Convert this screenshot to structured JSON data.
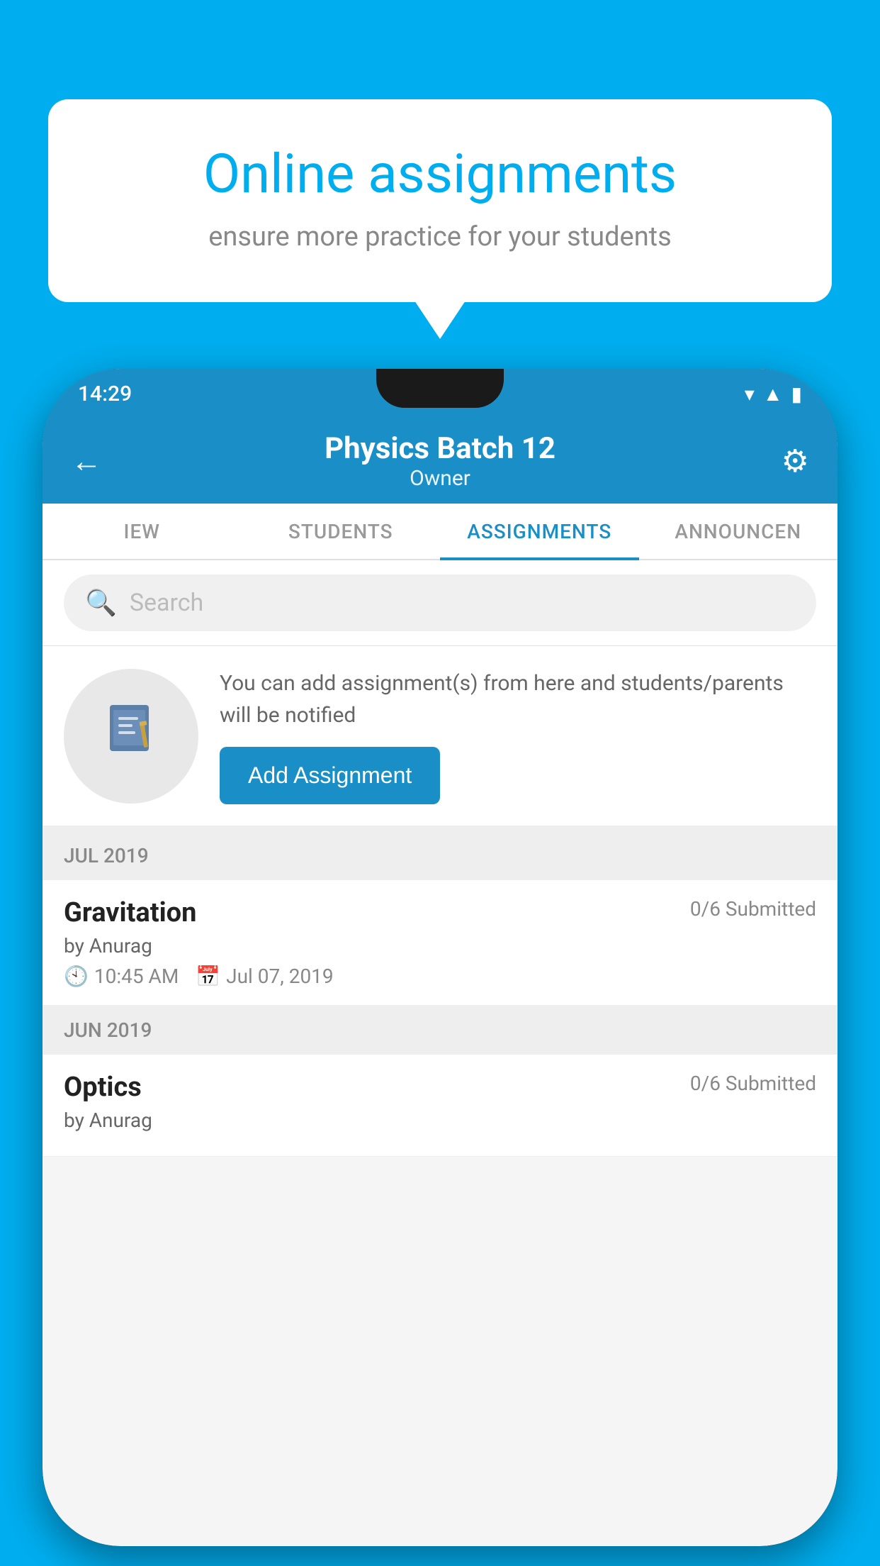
{
  "background_color": "#00AEEF",
  "info_card": {
    "title": "Online assignments",
    "subtitle": "ensure more practice for your students"
  },
  "phone": {
    "status_bar": {
      "time": "14:29",
      "icons": [
        "wifi",
        "signal",
        "battery"
      ]
    },
    "top_bar": {
      "title": "Physics Batch 12",
      "subtitle": "Owner",
      "back_label": "←",
      "settings_label": "⚙"
    },
    "tabs": [
      {
        "label": "IEW",
        "active": false
      },
      {
        "label": "STUDENTS",
        "active": false
      },
      {
        "label": "ASSIGNMENTS",
        "active": true
      },
      {
        "label": "ANNOUNCEN",
        "active": false
      }
    ],
    "search": {
      "placeholder": "Search"
    },
    "promo": {
      "icon": "📓",
      "text": "You can add assignment(s) from here and students/parents will be notified",
      "button_label": "Add Assignment"
    },
    "months": [
      {
        "label": "JUL 2019",
        "assignments": [
          {
            "name": "Gravitation",
            "submitted": "0/6 Submitted",
            "by": "by Anurag",
            "time": "10:45 AM",
            "date": "Jul 07, 2019"
          }
        ]
      },
      {
        "label": "JUN 2019",
        "assignments": [
          {
            "name": "Optics",
            "submitted": "0/6 Submitted",
            "by": "by Anurag",
            "time": "",
            "date": ""
          }
        ]
      }
    ]
  }
}
